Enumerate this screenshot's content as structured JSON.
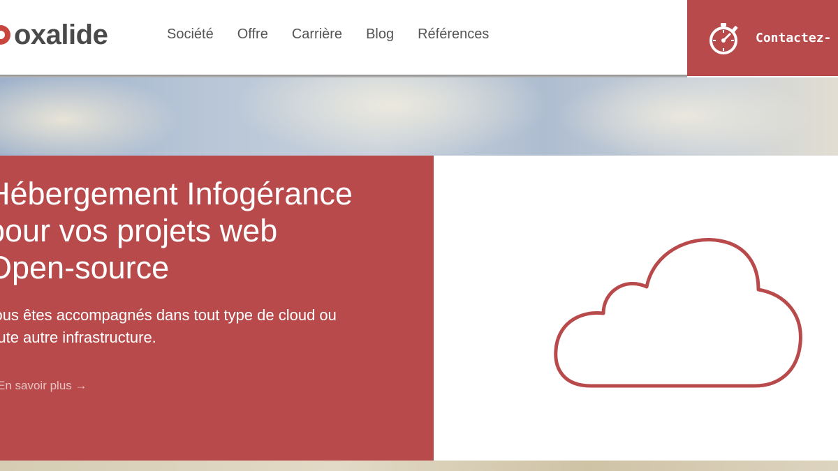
{
  "brand": {
    "name": "oxalide",
    "accent": "#b94a4c"
  },
  "nav": {
    "items": [
      {
        "label": "Société"
      },
      {
        "label": "Offre"
      },
      {
        "label": "Carrière"
      },
      {
        "label": "Blog"
      },
      {
        "label": "Références"
      }
    ]
  },
  "contact": {
    "label": "Contactez-",
    "icon": "stopwatch-icon"
  },
  "hero": {
    "title_lines": [
      "Hébergement Infogérance",
      "pour vos projets web",
      "Open-source"
    ],
    "subtitle_lines": [
      "Vous êtes accompagnés dans tout type de cloud ou",
      "toute autre infrastructure."
    ],
    "link_label": "En savoir plus →",
    "illustration": "cloud-icon",
    "background_left": "#b84a4b",
    "background_right": "#ffffff"
  }
}
